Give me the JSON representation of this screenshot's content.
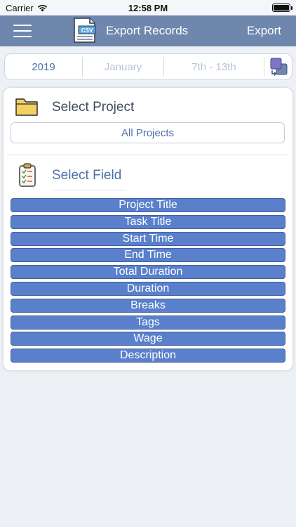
{
  "status_bar": {
    "carrier": "Carrier",
    "time": "12:58 PM"
  },
  "nav": {
    "title": "Export Records",
    "export_label": "Export",
    "csv_badge": "CSV"
  },
  "date_filter": {
    "year": "2019",
    "month": "January",
    "week": "7th - 13th"
  },
  "project": {
    "title": "Select Project",
    "selected": "All Projects"
  },
  "field": {
    "title": "Select Field"
  },
  "fields": [
    {
      "label": "Project Title"
    },
    {
      "label": "Task Title"
    },
    {
      "label": "Start Time"
    },
    {
      "label": "End Time"
    },
    {
      "label": "Total Duration"
    },
    {
      "label": "Duration"
    },
    {
      "label": "Breaks"
    },
    {
      "label": "Tags"
    },
    {
      "label": "Wage"
    },
    {
      "label": "Description"
    }
  ],
  "colors": {
    "nav": "#6f86ad",
    "accent": "#4e6fa8",
    "field_button": "#5a80cc",
    "background": "#edf1f5"
  }
}
